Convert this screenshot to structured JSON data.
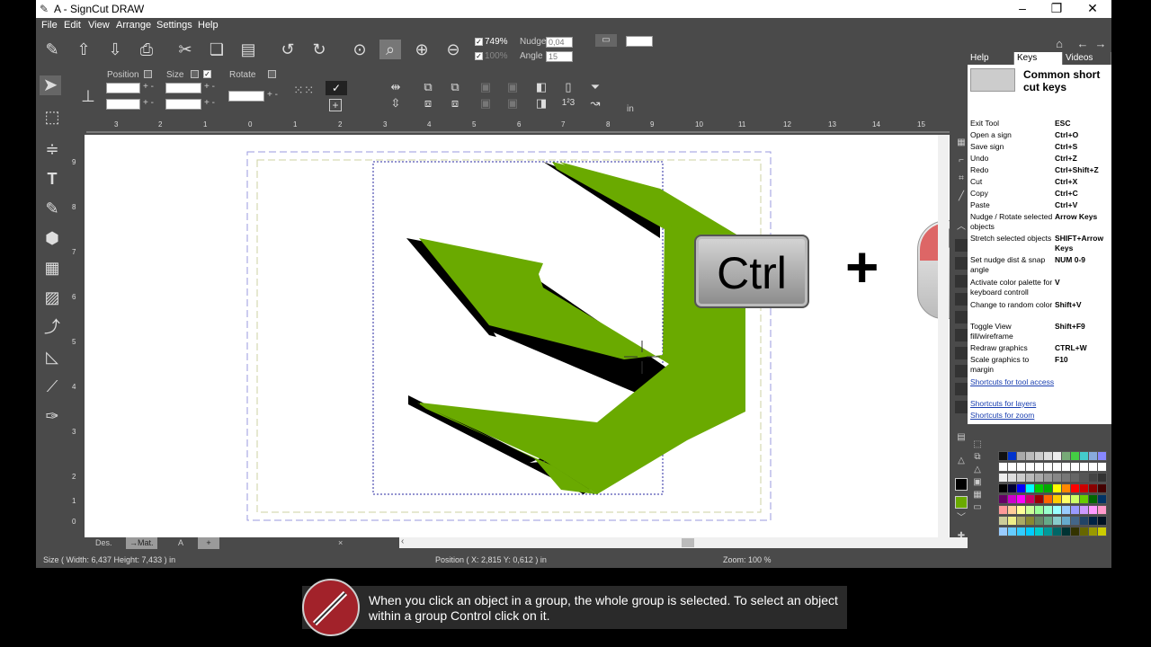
{
  "window": {
    "title": "A - SignCut DRAW"
  },
  "menu": [
    "File",
    "Edit",
    "View",
    "Arrange",
    "Settings",
    "Help"
  ],
  "toolbar": {
    "zoom_value": "749%",
    "zoom_value2": "100%",
    "nudge_label": "Nudge",
    "nudge_value": "0,04",
    "angle_label": "Angle",
    "angle_value": "15"
  },
  "props": {
    "position_label": "Position",
    "size_label": "Size",
    "rotate_label": "Rotate",
    "unit": "in"
  },
  "ruler_h": [
    "3",
    "2",
    "1",
    "0",
    "1",
    "2",
    "3",
    "4",
    "5",
    "6",
    "7",
    "8",
    "9",
    "10",
    "11",
    "12",
    "13",
    "14",
    "15"
  ],
  "ruler_v": [
    "9",
    "8",
    "7",
    "6",
    "5",
    "4",
    "3",
    "2",
    "1",
    "0"
  ],
  "overlay": {
    "ctrl_label": "Ctrl",
    "plus": "+"
  },
  "tabs": {
    "des": "Des.",
    "mat": "→Mat.",
    "a": "A",
    "add": "+",
    "close": "×"
  },
  "status": {
    "size": "Size  ( Width: 6,437  Height: 7,433 )  in",
    "position": "Position  ( X: 2,815   Y: 0,612 )  in",
    "zoom": "Zoom: 100 %"
  },
  "panel": {
    "tabs": [
      "Help",
      "Keys",
      "Videos"
    ],
    "header": "Common short cut keys",
    "shortcuts": [
      {
        "action": "Exit Tool",
        "key": "ESC"
      },
      {
        "action": "Open a sign",
        "key": "Ctrl+O"
      },
      {
        "action": "Save sign",
        "key": "Ctrl+S"
      },
      {
        "action": "Undo",
        "key": "Ctrl+Z"
      },
      {
        "action": "Redo",
        "key": "Ctrl+Shift+Z"
      },
      {
        "action": "Cut",
        "key": "Ctrl+X"
      },
      {
        "action": "Copy",
        "key": "Ctrl+C"
      },
      {
        "action": "Paste",
        "key": "Ctrl+V"
      },
      {
        "action": "Nudge / Rotate selected objects",
        "key": "Arrow Keys"
      },
      {
        "action": "Stretch selected objects",
        "key": "SHIFT+Arrow Keys"
      },
      {
        "action": "Set nudge dist & snap angle",
        "key": "NUM 0-9"
      },
      {
        "action": "Activate color palette for keyboard controll",
        "key": "V"
      },
      {
        "action": "Change to random color",
        "key": "Shift+V"
      },
      {
        "action": "Toggle View fill/wireframe",
        "key": "Shift+F9"
      },
      {
        "action": "Redraw graphics",
        "key": "CTRL+W"
      },
      {
        "action": "Scale graphics to margin",
        "key": "F10"
      }
    ],
    "links": [
      "Shortcuts for tool access",
      "Shortcuts for layers",
      "Shortcuts for zoom"
    ]
  },
  "caption": {
    "text": "When you click an object in a group, the whole group is selected. To select an object within a group Control click on it."
  },
  "colors": {
    "accent_green": "#6aaa00",
    "caption_red": "#a2222a"
  }
}
